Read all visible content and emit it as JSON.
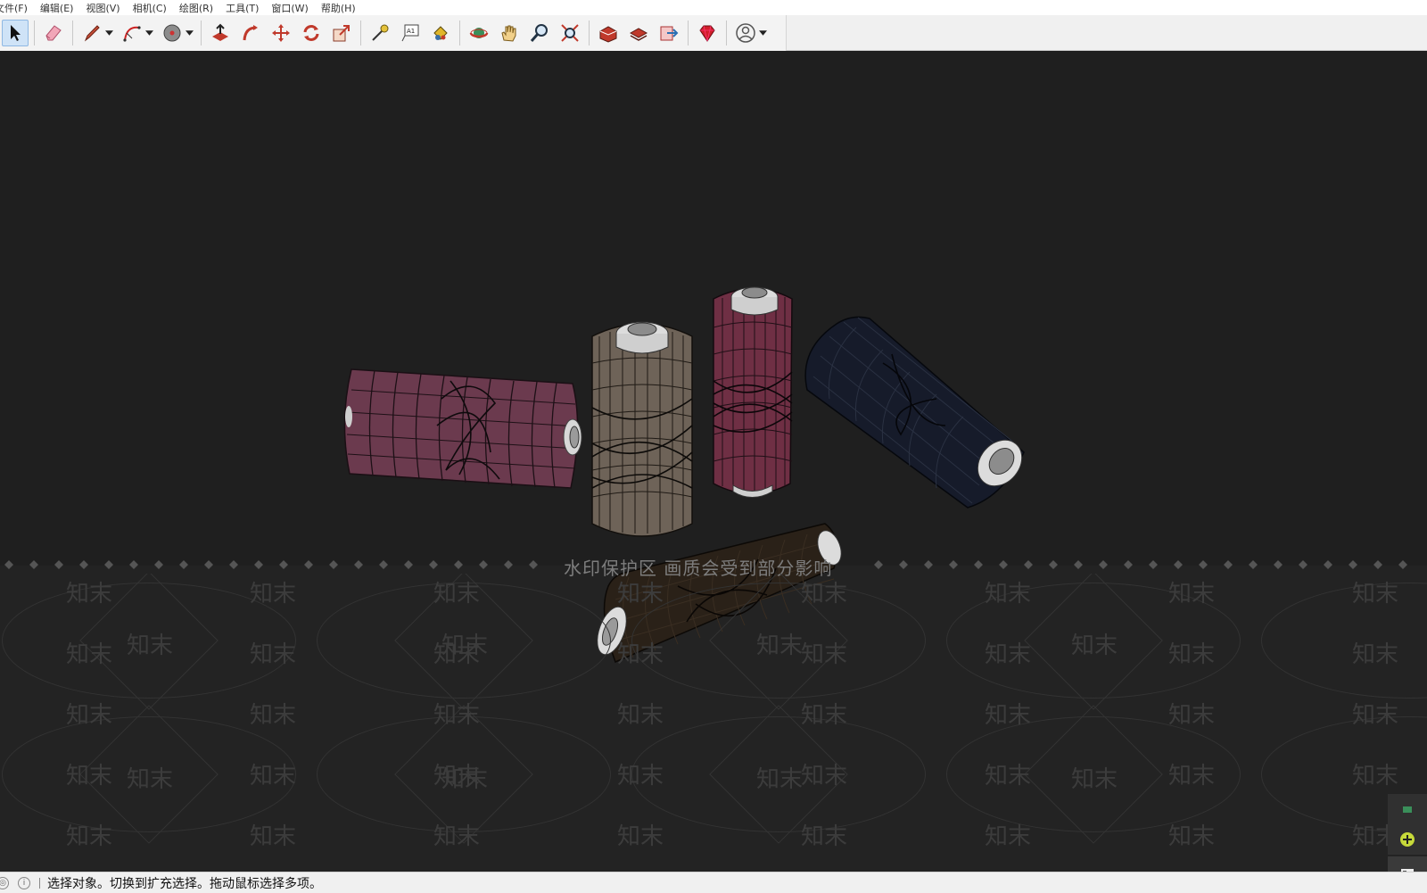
{
  "menus": [
    {
      "label": "文件(F)"
    },
    {
      "label": "编辑(E)"
    },
    {
      "label": "视图(V)"
    },
    {
      "label": "相机(C)"
    },
    {
      "label": "绘图(R)"
    },
    {
      "label": "工具(T)"
    },
    {
      "label": "窗口(W)"
    },
    {
      "label": "帮助(H)"
    }
  ],
  "toolbar": {
    "groups": [
      [
        "select-icon",
        "eraser-icon",
        "pencil-icon",
        "arc-icon",
        "paint-bucket-icon"
      ],
      [
        "push-pull-icon",
        "follow-me-icon",
        "move-icon",
        "rotate-icon",
        "scale-icon"
      ],
      [
        "tape-measure-icon",
        "text-icon",
        "paint-icon"
      ],
      [
        "orbit-icon",
        "pan-icon",
        "zoom-icon",
        "zoom-extents-icon"
      ],
      [
        "warehouse-icon",
        "extension-warehouse-icon",
        "send-to-layout-icon"
      ],
      [
        "ruby-icon"
      ],
      [
        "account-icon"
      ]
    ]
  },
  "viewport": {
    "watermark_notice": "水印保护区 画质会受到部分影响",
    "watermark_text": "知末"
  },
  "status": {
    "text": "选择对象。切换到扩充选择。拖动鼠标选择多项。"
  },
  "colors": {
    "background": "#1f1f1f",
    "spool_pink": "#6b3a4e",
    "spool_beige": "#6e6358",
    "spool_red": "#6f2f44",
    "spool_navy": "#161b2a",
    "spool_brown": "#2a2118",
    "spool_core": "#d8d8d8"
  }
}
